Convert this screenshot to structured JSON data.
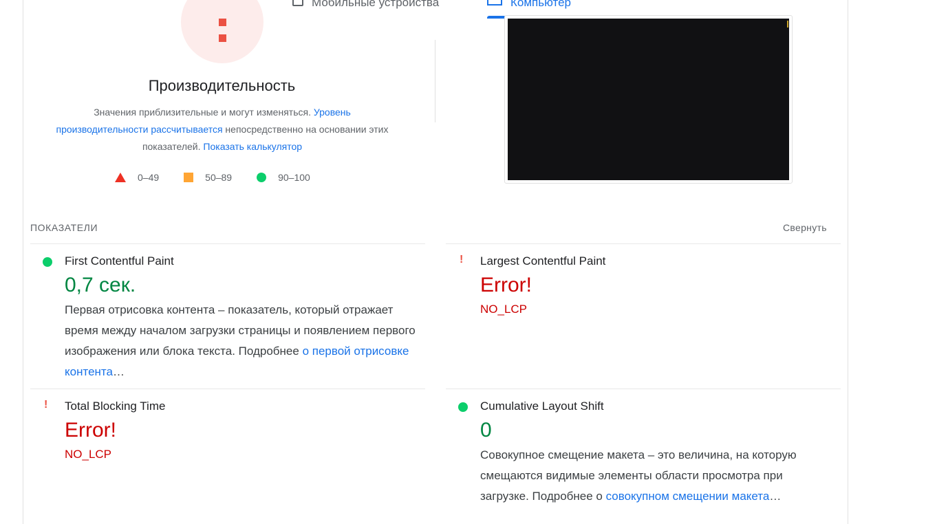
{
  "tabs": {
    "mobile_label": "Мобильные устройства",
    "desktop_label": "Компьютер"
  },
  "gauge": {
    "category": "Производительность",
    "status_color": "#eb5143"
  },
  "performance": {
    "desc_text_1": "Значения приблизительные и могут изменяться. ",
    "desc_link_1": "Уровень производительности рассчитывается",
    "desc_text_2": " непосредственно на основании этих показателей. ",
    "desc_link_2": "Показать калькулятор"
  },
  "legend": {
    "fail_range": "0–49",
    "average_range": "50–89",
    "pass_range": "90–100",
    "fail_color": "#ee3124",
    "average_color": "#ffa534",
    "pass_color": "#0cce6b"
  },
  "metrics_section": {
    "header": "ПОКАЗАТЕЛИ",
    "collapse_label": "Свернуть"
  },
  "metrics": {
    "fcp": {
      "title": "First Contentful Paint",
      "value": "0,7 сек.",
      "status_icon": "green-circle-icon",
      "desc_text": "Первая отрисовка контента – показатель, который отражает время между началом загрузки страницы и появлением первого изображения или блока текста. Подробнее ",
      "desc_link": "о первой отрисовке контента",
      "desc_tail": "…"
    },
    "lcp": {
      "title": "Largest Contentful Paint",
      "value": "Error!",
      "code": "NO_LCP",
      "status_icon": "exclamation-icon"
    },
    "tbt": {
      "title": "Total Blocking Time",
      "value": "Error!",
      "code": "NO_LCP",
      "status_icon": "exclamation-icon"
    },
    "cls": {
      "title": "Cumulative Layout Shift",
      "value": "0",
      "status_icon": "green-circle-icon",
      "desc_text": "Совокупное смещение макета – это величина, на которую смещаются видимые элементы области просмотра при загрузке. Подробнее о ",
      "desc_link": "совокупном смещении макета",
      "desc_tail": "…"
    }
  }
}
